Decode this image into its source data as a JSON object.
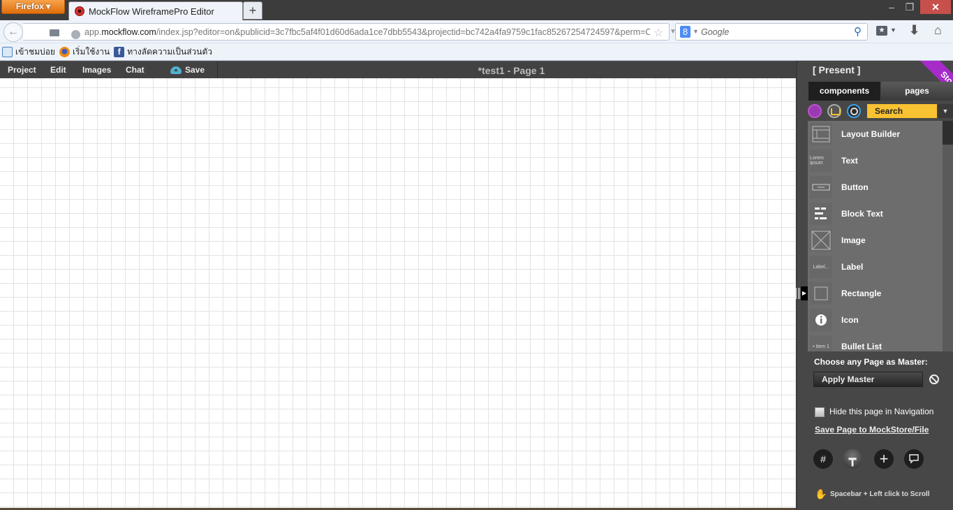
{
  "browser": {
    "menu_button": "Firefox ▾",
    "tab_title": "MockFlow WireframePro Editor",
    "new_tab": "+",
    "window_controls": {
      "minimize": "–",
      "maximize": "❐",
      "close": "✕"
    },
    "url_prefix": "app.",
    "url_domain": "mockflow.com",
    "url_rest": "/index.jsp?editor=on&publicid=3c7fbc5af4f01d60d6ada1ce7dbb5543&projectid=bc742a4fa9759c1fac85267254724597&perm=Owner&",
    "search_placeholder": "Google",
    "search_engine_icon": "8",
    "bookmarks": [
      {
        "label": "เข้าชมบ่อย",
        "icon": "most-visited-icon"
      },
      {
        "label": "เริ่มใช้งาน",
        "icon": "firefox-icon"
      },
      {
        "label": "ทางลัดความเป็นส่วนตัว",
        "icon": "facebook-icon"
      }
    ]
  },
  "app": {
    "menu": {
      "project": "Project",
      "edit": "Edit",
      "images": "Images",
      "chat": "Chat",
      "save": "Save"
    },
    "document_title": "*test1 - Page 1"
  },
  "panel": {
    "present": "[ Present ]",
    "store_ribbon": "Store",
    "tabs": {
      "components": "components",
      "pages": "pages"
    },
    "search_label": "Search",
    "components": [
      {
        "label": "Layout Builder",
        "icon": "layout-builder-icon"
      },
      {
        "label": "Text",
        "icon": "text-icon",
        "thumb": "Lorem ipsum"
      },
      {
        "label": "Button",
        "icon": "button-icon",
        "thumb": "Button"
      },
      {
        "label": "Block Text",
        "icon": "block-text-icon"
      },
      {
        "label": "Image",
        "icon": "image-icon"
      },
      {
        "label": "Label",
        "icon": "label-icon",
        "thumb": "Label..."
      },
      {
        "label": "Rectangle",
        "icon": "rectangle-icon"
      },
      {
        "label": "Icon",
        "icon": "info-icon",
        "thumb": "i"
      },
      {
        "label": "Bullet List",
        "icon": "bullet-list-icon",
        "thumb": "• Item 1"
      }
    ],
    "master_label": "Choose any Page as Master:",
    "apply_master": "Apply Master",
    "hide_in_nav": "Hide this page in Navigation",
    "hide_in_nav_checked": false,
    "save_page_link": "Save Page to MockStore/File",
    "tools": {
      "grid": "#",
      "ruler": "┳",
      "add": "+",
      "comment": "🗨"
    },
    "scroll_tip": "Spacebar + Left click to Scroll"
  }
}
